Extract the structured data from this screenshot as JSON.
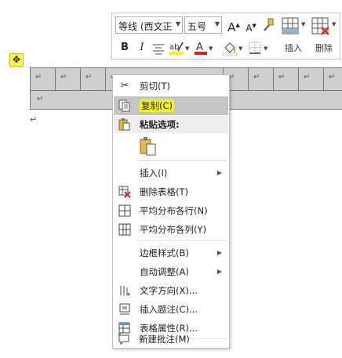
{
  "table": {
    "cell_mark": "↵",
    "paragraph_mark": "↵",
    "move_handle_symbol": "✥"
  },
  "toolbar": {
    "font_name": "等线 (西文正",
    "font_size": "五号",
    "grow_font": "A",
    "shrink_font": "A",
    "bold": "B",
    "italic": "I",
    "insert_label": "插入",
    "delete_label": "删除"
  },
  "menu": {
    "cut": "剪切(T)",
    "copy": "复制(C)",
    "paste_options": "粘贴选项:",
    "insert": "插入(I)",
    "delete_table": "删除表格(T)",
    "distribute_rows": "平均分布各行(N)",
    "distribute_columns": "平均分布各列(Y)",
    "border_styles": "边框样式(B)",
    "autofit": "自动调整(A)",
    "text_direction": "文字方向(X)...",
    "insert_caption": "插入题注(C)...",
    "table_properties": "表格属性(R)...",
    "new_comment": "新建批注(M)"
  },
  "colors": {
    "highlight": "#f6f21c",
    "font_color": "#e0201b",
    "menu_hover": "#c5c5c5",
    "table_shading": "#cfcfcf"
  },
  "icons": [
    "move-handle-icon",
    "grow-font-icon",
    "shrink-font-icon",
    "format-painter-icon",
    "insert-table-icon",
    "delete-table-icon",
    "bold-icon",
    "italic-icon",
    "align-center-icon",
    "text-highlight-icon",
    "font-color-icon",
    "shading-icon",
    "borders-icon",
    "scissors-icon",
    "copy-icon",
    "paste-icon",
    "paste-keep-text-icon",
    "delete-table-icon",
    "distribute-rows-icon",
    "distribute-columns-icon",
    "text-direction-icon",
    "caption-icon",
    "table-properties-icon",
    "new-comment-icon"
  ]
}
